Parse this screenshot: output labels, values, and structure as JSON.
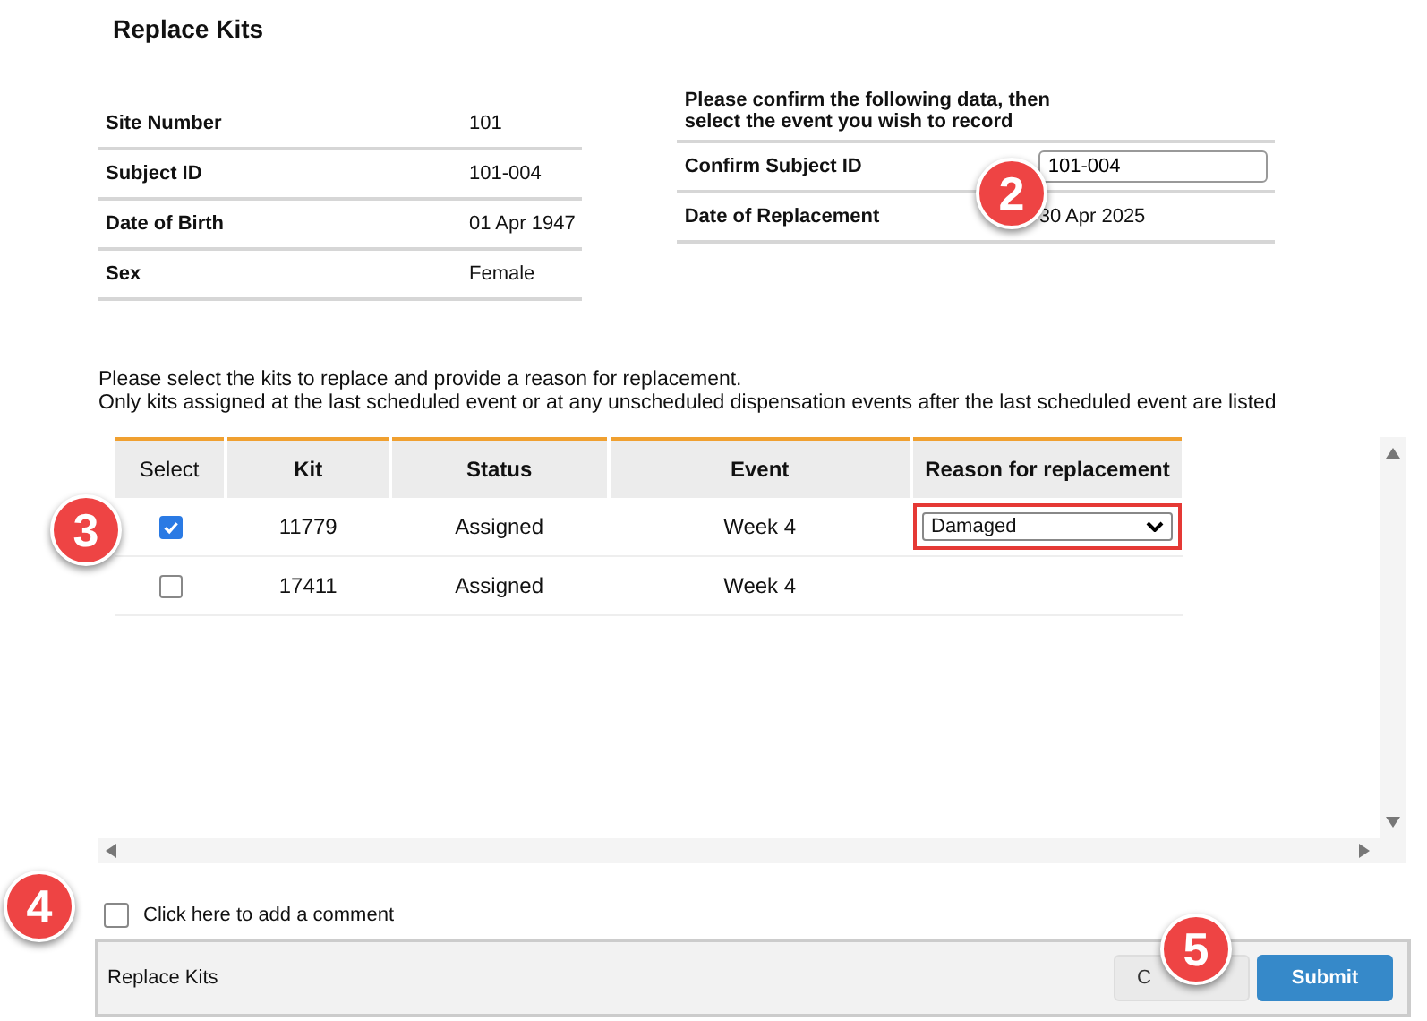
{
  "title": "Replace Kits",
  "subject_info": [
    {
      "label": "Site Number",
      "value": "101"
    },
    {
      "label": "Subject ID",
      "value": "101-004"
    },
    {
      "label": "Date of Birth",
      "value": "01 Apr 1947"
    },
    {
      "label": "Sex",
      "value": "Female"
    }
  ],
  "confirm": {
    "instruction": "Please confirm the following data, then select the event you wish to record",
    "fields": [
      {
        "label": "Confirm Subject ID",
        "kind": "input",
        "value": "101-004"
      },
      {
        "label": "Date of Replacement",
        "kind": "text",
        "value": "30 Apr 2025"
      }
    ]
  },
  "instructions": [
    "Please select the kits to replace and provide a reason for replacement.",
    "Only kits assigned at the last scheduled event or at any unscheduled dispensation events after the last scheduled event are listed"
  ],
  "kits_table": {
    "columns": [
      "Select",
      "Kit",
      "Status",
      "Event",
      "Reason for replacement"
    ],
    "rows": [
      {
        "selected": true,
        "kit": "11779",
        "status": "Assigned",
        "event": "Week 4",
        "reason": {
          "value": "Damaged",
          "highlighted": true
        }
      },
      {
        "selected": false,
        "kit": "17411",
        "status": "Assigned",
        "event": "Week 4"
      }
    ]
  },
  "comment": {
    "label": "Click here to add a comment",
    "checked": false
  },
  "footer": {
    "title": "Replace Kits",
    "buttons": [
      {
        "label": "C",
        "kind": "secondary"
      },
      {
        "label": "Submit",
        "kind": "primary"
      }
    ]
  },
  "callouts": [
    "2",
    "3",
    "4",
    "5"
  ]
}
